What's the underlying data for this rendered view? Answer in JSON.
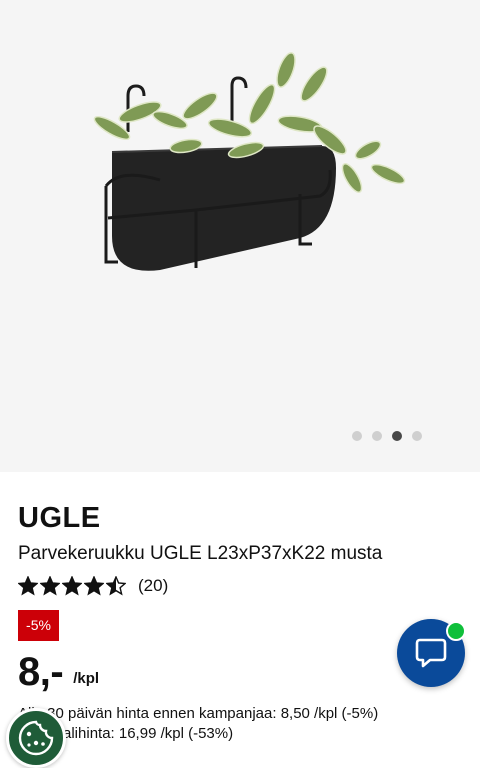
{
  "product": {
    "brand": "UGLE",
    "description": "Parvekeruukku UGLE L23xP37xK22 musta",
    "image_icon": "planter-with-plant-image"
  },
  "rating": {
    "value": 4.5,
    "max": 5,
    "count_text": "(20)"
  },
  "gallery": {
    "total_images": 4,
    "active_index": 2
  },
  "pricing": {
    "discount_badge": "-5%",
    "price": "8,-",
    "unit": "/kpl",
    "previous_price_text": "Alin 30 päivän hinta ennen kampanjaa: 8,50 /kpl (-5%)",
    "regular_price_text": "Normaalihinta: 16,99 /kpl (-53%)"
  },
  "chat": {
    "icon": "chat-bubble-icon",
    "status": "online"
  },
  "cookie": {
    "icon": "cookie-icon"
  },
  "colors": {
    "badge_red": "#cc0008",
    "chat_blue": "#0a4a9a",
    "online_green": "#0fbf3a",
    "cookie_green": "#1f5c38",
    "gallery_bg": "#f5f5f5"
  }
}
